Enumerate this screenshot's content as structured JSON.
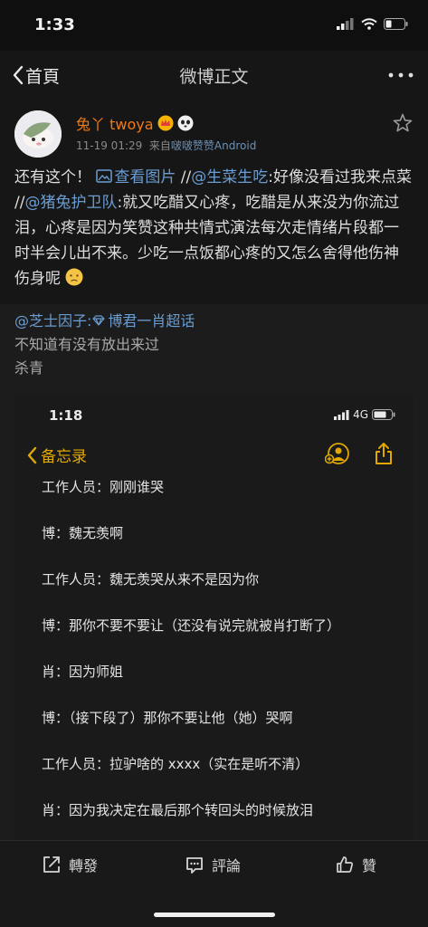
{
  "status_bar": {
    "time": "1:33"
  },
  "nav": {
    "back_label": "首頁",
    "title": "微博正文"
  },
  "post": {
    "username": "兔丫 twoya",
    "timestamp": "11-19 01:29",
    "source_prefix": "来自",
    "client": "啵啵赞赞Android",
    "text_1": "还有这个！ ",
    "link_view_image": "查看图片",
    "text_2": " //",
    "mention_1": "@生菜生吃",
    "text_3": ":好像没看过我来点菜 //",
    "mention_2": "@猪兔护卫队",
    "text_4": ":就又吃醋又心疼，吃醋是从来没为你流过泪，心疼是因为笑赞这种共情式演法每次走情绪片段都一时半会儿出不来。少吃一点饭都心疼的又怎么舍得他伤神伤身呢 "
  },
  "quote": {
    "author_mention": "@芝士因子",
    "separator": ":",
    "topic": "博君一肖超话",
    "line_1": "不知道有没有放出来过",
    "line_2": "杀青"
  },
  "screenshot": {
    "time": "1:18",
    "network": "4G",
    "back_label": "备忘录",
    "lines": [
      "工作人员：刚刚谁哭",
      "博：魏无羡啊",
      "工作人员：魏无羡哭从来不是因为你",
      "博：那你不要不要让（还没有说完就被肖打断了）",
      "肖：因为师姐",
      "博：（接下段了）那你不要让他（她）哭啊",
      "工作人员：拉驴啥的 xxxx（实在是听不清）",
      "肖：因为我决定在最后那个转回头的时候放泪"
    ]
  },
  "actions": {
    "repost": "轉發",
    "comment": "評論",
    "like": "贊"
  },
  "colors": {
    "accent_orange": "#ef7b16",
    "link_blue": "#6a9dd3",
    "memo_yellow": "#e0a800"
  }
}
